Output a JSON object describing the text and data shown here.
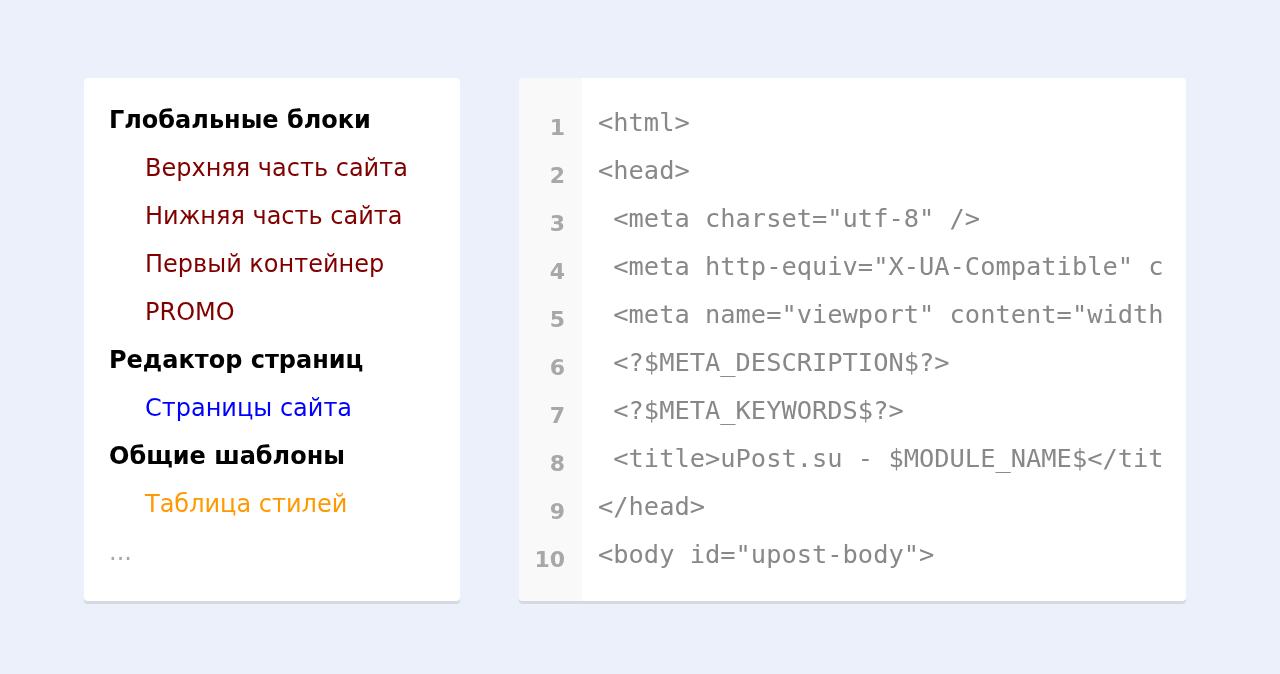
{
  "menu": [
    {
      "title": "Глобальные блоки",
      "children": [
        {
          "label": "Верхняя часть сайта",
          "color": "#800000"
        },
        {
          "label": "Нижняя часть сайта",
          "color": "#800000"
        },
        {
          "label": "Первый контейнер",
          "color": "#800000"
        },
        {
          "label": "PROMO",
          "color": "#800000"
        }
      ]
    },
    {
      "title": "Редактор страниц",
      "children": [
        {
          "label": "Страницы сайта",
          "color": "#0000ff"
        }
      ]
    },
    {
      "title": "Общие шаблоны",
      "children": [
        {
          "label": "Таблица стилей",
          "color": "#ff9900"
        }
      ]
    }
  ],
  "more": "...",
  "code": [
    {
      "number": "1",
      "text": "<html>"
    },
    {
      "number": "2",
      "text": "<head>"
    },
    {
      "number": "3",
      "text": " <meta charset=\"utf-8\" />"
    },
    {
      "number": "4",
      "text": " <meta http-equiv=\"X-UA-Compatible\" c"
    },
    {
      "number": "5",
      "text": " <meta name=\"viewport\" content=\"width"
    },
    {
      "number": "6",
      "text": " <?$META_DESCRIPTION$?>"
    },
    {
      "number": "7",
      "text": " <?$META_KEYWORDS$?>"
    },
    {
      "number": "8",
      "text": " <title>uPost.su - $MODULE_NAME$</tit"
    },
    {
      "number": "9",
      "text": "</head>"
    },
    {
      "number": "10",
      "text": "<body id=\"upost-body\">"
    }
  ]
}
